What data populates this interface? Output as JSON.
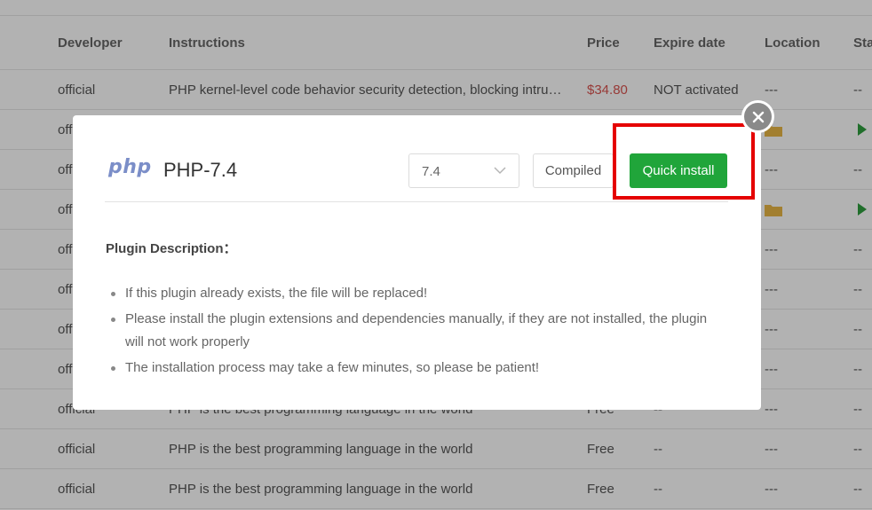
{
  "table": {
    "headers": {
      "developer": "Developer",
      "instructions": "Instructions",
      "price": "Price",
      "expire": "Expire date",
      "location": "Location",
      "status": "Sta"
    },
    "rows": [
      {
        "developer": "official",
        "instructions": "PHP kernel-level code behavior security detection, blocking intrusi...",
        "price": "$34.80",
        "expire": "NOT activated",
        "location": "---",
        "status": "--"
      },
      {
        "developer": "offi",
        "location_icon": "folder-icon",
        "status_icon": "play-icon"
      },
      {
        "developer": "offi",
        "location": "---",
        "status": "--"
      },
      {
        "developer": "offi",
        "location_icon": "folder-icon",
        "status_icon": "play-icon"
      },
      {
        "developer": "offi",
        "location": "---",
        "status": "--"
      },
      {
        "developer": "offi",
        "location": "---",
        "status": "--"
      },
      {
        "developer": "offi",
        "location": "---",
        "status": "--"
      },
      {
        "developer": "offi",
        "location": "---",
        "status": "--"
      },
      {
        "developer": "official",
        "instructions": "PHP is the best programming language in the world",
        "price": "Free",
        "expire": "--",
        "location": "---",
        "status": "--"
      },
      {
        "developer": "official",
        "instructions": "PHP is the best programming language in the world",
        "price": "Free",
        "expire": "--",
        "location": "---",
        "status": "--"
      },
      {
        "developer": "official",
        "instructions": "PHP is the best programming language in the world",
        "price": "Free",
        "expire": "--",
        "location": "---",
        "status": "--"
      }
    ]
  },
  "modal": {
    "logo_text": "php",
    "title": "PHP-7.4",
    "version_select": {
      "value": "7.4"
    },
    "compiled_label": "Compiled",
    "install_label": "Quick install",
    "description_title": "Plugin Description：",
    "description_items": [
      "If this plugin already exists, the file will be replaced!",
      "Please install the plugin extensions and dependencies manually, if they are not installed, the plugin will not work properly",
      "The installation process may take a few minutes, so please be patient!"
    ]
  },
  "colors": {
    "install_green": "#20a53a",
    "highlight_red": "#e50000",
    "price_red": "#d9534f",
    "php_logo": "#7b8ec8"
  }
}
